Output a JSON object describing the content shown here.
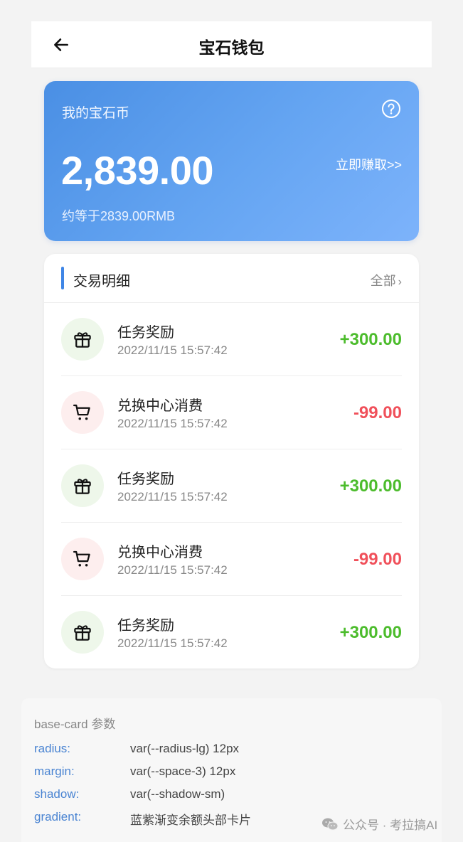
{
  "header": {
    "title": "宝石钱包"
  },
  "balance": {
    "label": "我的宝石币",
    "amount": "2,839.00",
    "earn_link": "立即赚取>>",
    "approx": "约等于2839.00RMB"
  },
  "transactions": {
    "title": "交易明细",
    "all_label": "全部",
    "items": [
      {
        "type": "income",
        "icon": "gift-icon",
        "name": "任务奖励",
        "time": "2022/11/15 15:57:42",
        "amount": "+300.00"
      },
      {
        "type": "expense",
        "icon": "cart-icon",
        "name": "兑换中心消费",
        "time": "2022/11/15 15:57:42",
        "amount": "-99.00"
      },
      {
        "type": "income",
        "icon": "gift-icon",
        "name": "任务奖励",
        "time": "2022/11/15 15:57:42",
        "amount": "+300.00"
      },
      {
        "type": "expense",
        "icon": "cart-icon",
        "name": "兑换中心消费",
        "time": "2022/11/15 15:57:42",
        "amount": "-99.00"
      },
      {
        "type": "income",
        "icon": "gift-icon",
        "name": "任务奖励",
        "time": "2022/11/15 15:57:42",
        "amount": "+300.00"
      }
    ]
  },
  "params": {
    "title": "base-card 参数",
    "rows": [
      {
        "key": "radius:",
        "value": "var(--radius-lg) 12px"
      },
      {
        "key": "margin:",
        "value": "var(--space-3) 12px"
      },
      {
        "key": "shadow:",
        "value": "var(--shadow-sm)"
      },
      {
        "key": "gradient:",
        "value": "蓝紫渐变余额头部卡片"
      }
    ]
  },
  "watermark": {
    "text": "公众号 · 考拉搞AI"
  },
  "colors": {
    "accent": "#3f86e6",
    "income": "#4cbc2c",
    "expense": "#f0505a",
    "card_gradient_start": "#4a8fe4",
    "card_gradient_end": "#7db3fb"
  }
}
